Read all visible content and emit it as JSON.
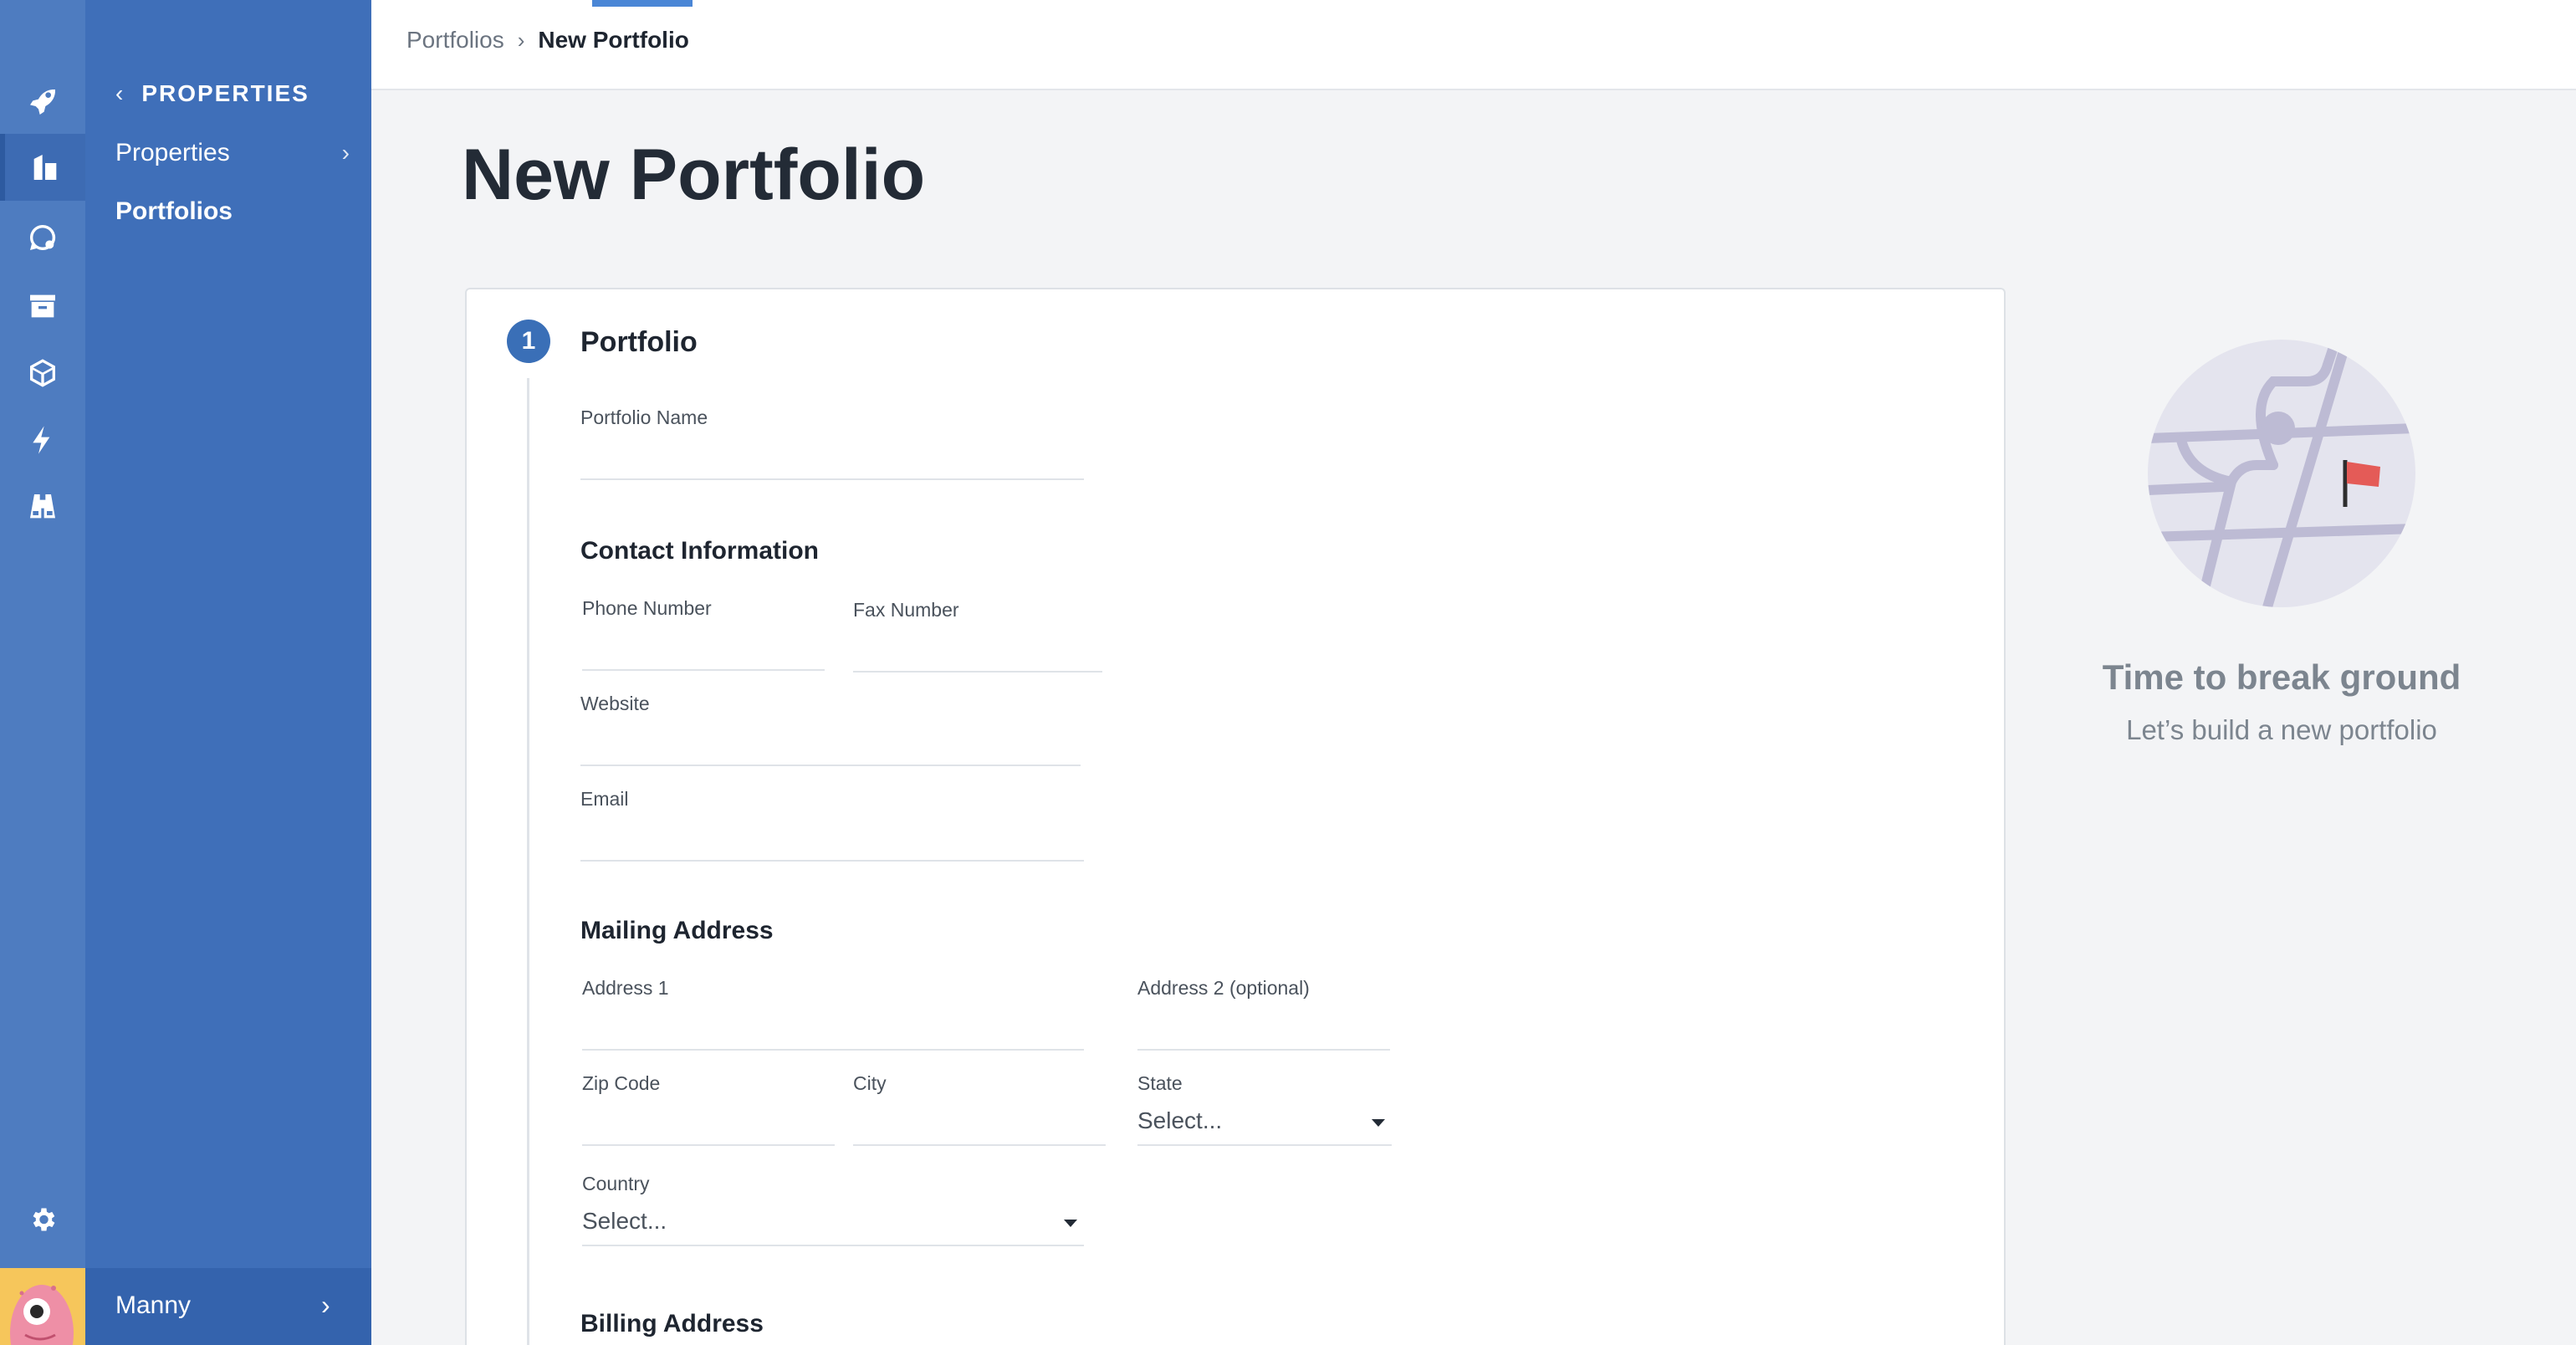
{
  "rail": {
    "icons": [
      "rocket-icon",
      "building-icon",
      "chat-icon",
      "archive-icon",
      "cube-icon",
      "bolt-icon",
      "binoculars-icon"
    ],
    "active_icon": "building-icon",
    "settings_icon": "gear-icon"
  },
  "sidebar": {
    "header": "PROPERTIES",
    "items": [
      {
        "label": "Properties"
      },
      {
        "label": "Portfolios"
      }
    ],
    "user_name": "Manny"
  },
  "breadcrumb": {
    "parent": "Portfolios",
    "current": "New Portfolio"
  },
  "page": {
    "title": "New Portfolio"
  },
  "form": {
    "step_number": "1",
    "title": "Portfolio",
    "portfolio_name_label": "Portfolio Name",
    "contact_title": "Contact Information",
    "phone_label": "Phone Number",
    "fax_label": "Fax Number",
    "website_label": "Website",
    "email_label": "Email",
    "mailing_title": "Mailing Address",
    "address1_label": "Address 1",
    "address2_label": "Address 2 (optional)",
    "zip_label": "Zip Code",
    "city_label": "City",
    "state_label": "State",
    "state_value": "Select...",
    "country_label": "Country",
    "country_value": "Select...",
    "billing_title": "Billing Address"
  },
  "empty_state": {
    "title": "Time to break ground",
    "subtitle": "Let’s build a new portfolio"
  },
  "colors": {
    "rail": "#4e7cc0",
    "sidebar": "#3f6fb9",
    "accent": "#3a6fb7",
    "flag": "#e45b57"
  }
}
